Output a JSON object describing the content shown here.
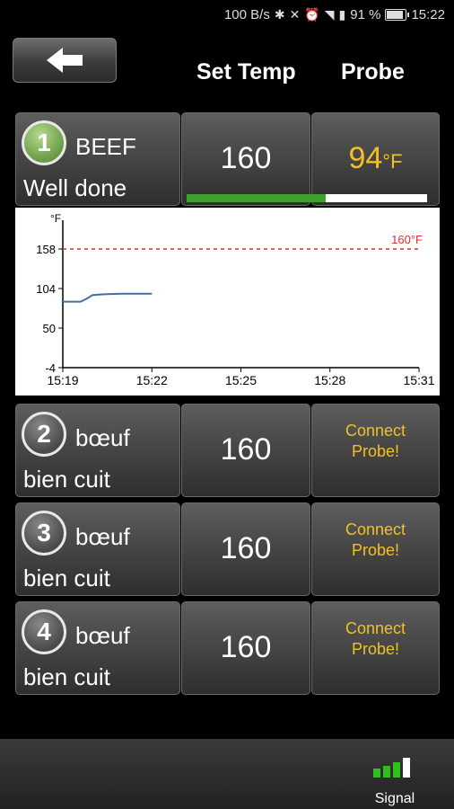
{
  "status_bar": {
    "speed": "100 B/s",
    "battery": "91 %",
    "time": "15:22"
  },
  "header": {
    "set_temp_label": "Set Temp",
    "probe_label": "Probe"
  },
  "probes": [
    {
      "number": "1",
      "meat": "BEEF",
      "doneness": "Well done",
      "set_temp": "160",
      "probe_value": "94",
      "probe_unit": "°F",
      "progress": 0.58
    },
    {
      "number": "2",
      "meat": "bœuf",
      "doneness": "bien cuit",
      "set_temp": "160",
      "connect_line1": "Connect",
      "connect_line2": "Probe!"
    },
    {
      "number": "3",
      "meat": "bœuf",
      "doneness": "bien cuit",
      "set_temp": "160",
      "connect_line1": "Connect",
      "connect_line2": "Probe!"
    },
    {
      "number": "4",
      "meat": "bœuf",
      "doneness": "bien cuit",
      "set_temp": "160",
      "connect_line1": "Connect",
      "connect_line2": "Probe!"
    }
  ],
  "chart_data": {
    "type": "line",
    "ylabel": "°F",
    "yticks": [
      "158",
      "104",
      "50",
      "-4"
    ],
    "xticks": [
      "15:19",
      "15:22",
      "15:25",
      "15:28",
      "15:31"
    ],
    "ylim": [
      -4,
      158
    ],
    "target_label": "160°F",
    "target_value": 160,
    "series": [
      {
        "x": [
          0,
          0.3,
          0.6,
          0.8,
          1.0,
          1.3,
          1.6,
          2.0,
          2.5,
          3.0
        ],
        "values": [
          86,
          86,
          86,
          90,
          95,
          96,
          96.5,
          97,
          97,
          97
        ]
      }
    ],
    "colors": {
      "line": "#3f6fa3",
      "target": "#d9302c"
    }
  },
  "bottom": {
    "signal_label": "Signal"
  },
  "colors": {
    "accent": "#f2c026",
    "progress": "#3ea02d",
    "signal": "#2fc01e"
  }
}
